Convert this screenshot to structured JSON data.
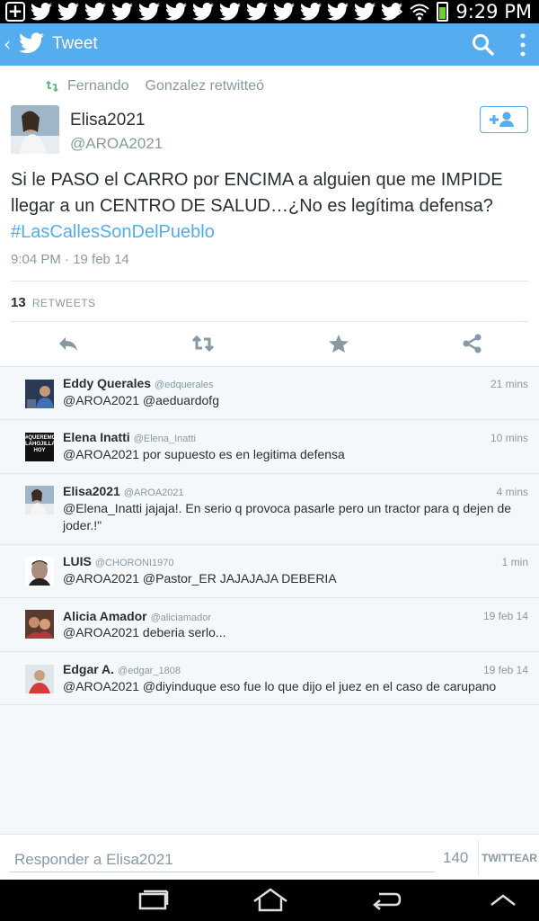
{
  "status_bar": {
    "time": "9:29 PM",
    "notification_icons": [
      "plus-icon",
      "twitter-bird-icon",
      "twitter-bird-icon",
      "twitter-bird-icon",
      "twitter-bird-icon",
      "twitter-bird-icon",
      "twitter-bird-icon",
      "twitter-bird-icon",
      "twitter-bird-icon",
      "twitter-bird-icon",
      "twitter-bird-icon",
      "twitter-bird-icon",
      "twitter-bird-icon",
      "twitter-bird-icon",
      "twitter-bird-icon"
    ],
    "system_icons": [
      "eye-icon",
      "wifi-icon",
      "battery-icon"
    ]
  },
  "app_bar": {
    "title": "Tweet",
    "icons": [
      "back-arrow-icon",
      "twitter-bird-icon",
      "search-icon",
      "overflow-menu-icon"
    ]
  },
  "tweet": {
    "retweeted_by": "Fernando",
    "retweeted_by_last": "Gonzalez retwitteó",
    "author_name": "Elisa2021",
    "author_handle": "@AROA2021",
    "text": "Si le PASO el CARRO por ENCIMA a alguien que me IMPIDE llegar a un CENTRO DE SALUD…¿No es legítima defensa?",
    "hashtag": "#LasCallesSonDelPueblo",
    "timestamp": "9:04 PM · 19 feb 14",
    "retweet_count": "13",
    "retweet_label": "RETWEETS",
    "actions": [
      "reply-icon",
      "retweet-icon",
      "favorite-icon",
      "share-icon"
    ]
  },
  "replies": [
    {
      "name": "Eddy Querales",
      "handle": "@edquerales",
      "time": "21 mins",
      "text": "@AROA2021 @aeduardofg"
    },
    {
      "name": "Elena Inatti",
      "handle": "@Elena_Inatti",
      "time": "10 mins",
      "text": "@AROA2021 por supuesto es en legitima defensa",
      "avatar_text": "#QUEREMOS LAHOJILLA HOY"
    },
    {
      "name": "Elisa2021",
      "handle": "@AROA2021",
      "time": "4 mins",
      "text": "@Elena_Inatti jajaja!. En serio q provoca pasarle pero un tractor para q dejen de joder.!\""
    },
    {
      "name": "LUIS",
      "handle": "@CHORONI1970",
      "time": "1 min",
      "text": "@AROA2021 @Pastor_ER JAJAJAJA DEBERIA"
    },
    {
      "name": "Alicia Amador",
      "handle": "@aliciamador",
      "time": "19 feb 14",
      "text": "@AROA2021 deberia serlo..."
    },
    {
      "name": "Edgar A.",
      "handle": "@edgar_1808",
      "time": "19 feb 14",
      "text": "@AROA2021 @diyinduque eso fue lo que dijo el juez en el caso de carupano"
    }
  ],
  "composer": {
    "placeholder": "Responder a Elisa2021",
    "char_count": "140",
    "button_label": "TWITTEAR"
  },
  "colors": {
    "accent": "#55acee",
    "text": "#292f33",
    "muted": "#8899a6",
    "retweet_green": "#5db87a"
  }
}
